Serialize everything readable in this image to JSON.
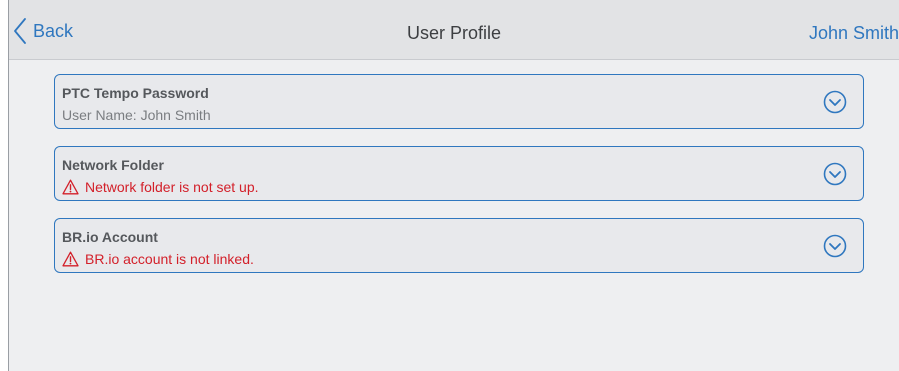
{
  "navbar": {
    "back_label": "Back",
    "title": "User Profile",
    "user_name": "John Smith"
  },
  "cards": [
    {
      "title": "PTC Tempo Password",
      "subtitle": "User Name: John Smith",
      "status": "info",
      "icon": "chevron-down-circle-icon"
    },
    {
      "title": "Network Folder",
      "subtitle": "Network folder is not set up.",
      "status": "warning",
      "icon": "chevron-down-circle-icon"
    },
    {
      "title": "BR.io Account",
      "subtitle": "BR.io account is not linked.",
      "status": "warning",
      "icon": "chevron-down-circle-icon"
    }
  ],
  "colors": {
    "accent": "#2f77bf",
    "error": "#d3202a",
    "background": "#eeeff1",
    "navbar": "#e2e3e5"
  }
}
